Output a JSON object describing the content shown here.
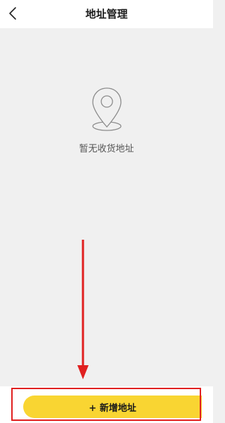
{
  "header": {
    "title": "地址管理",
    "back_icon": "chevron-left-icon"
  },
  "empty_state": {
    "icon": "location-pin-icon",
    "message": "暂无收货地址"
  },
  "footer": {
    "add_button_label": "+ 新增地址",
    "button_color": "#f9d532"
  },
  "annotation": {
    "arrow_color": "#e02020",
    "highlight_color": "#e02020"
  }
}
